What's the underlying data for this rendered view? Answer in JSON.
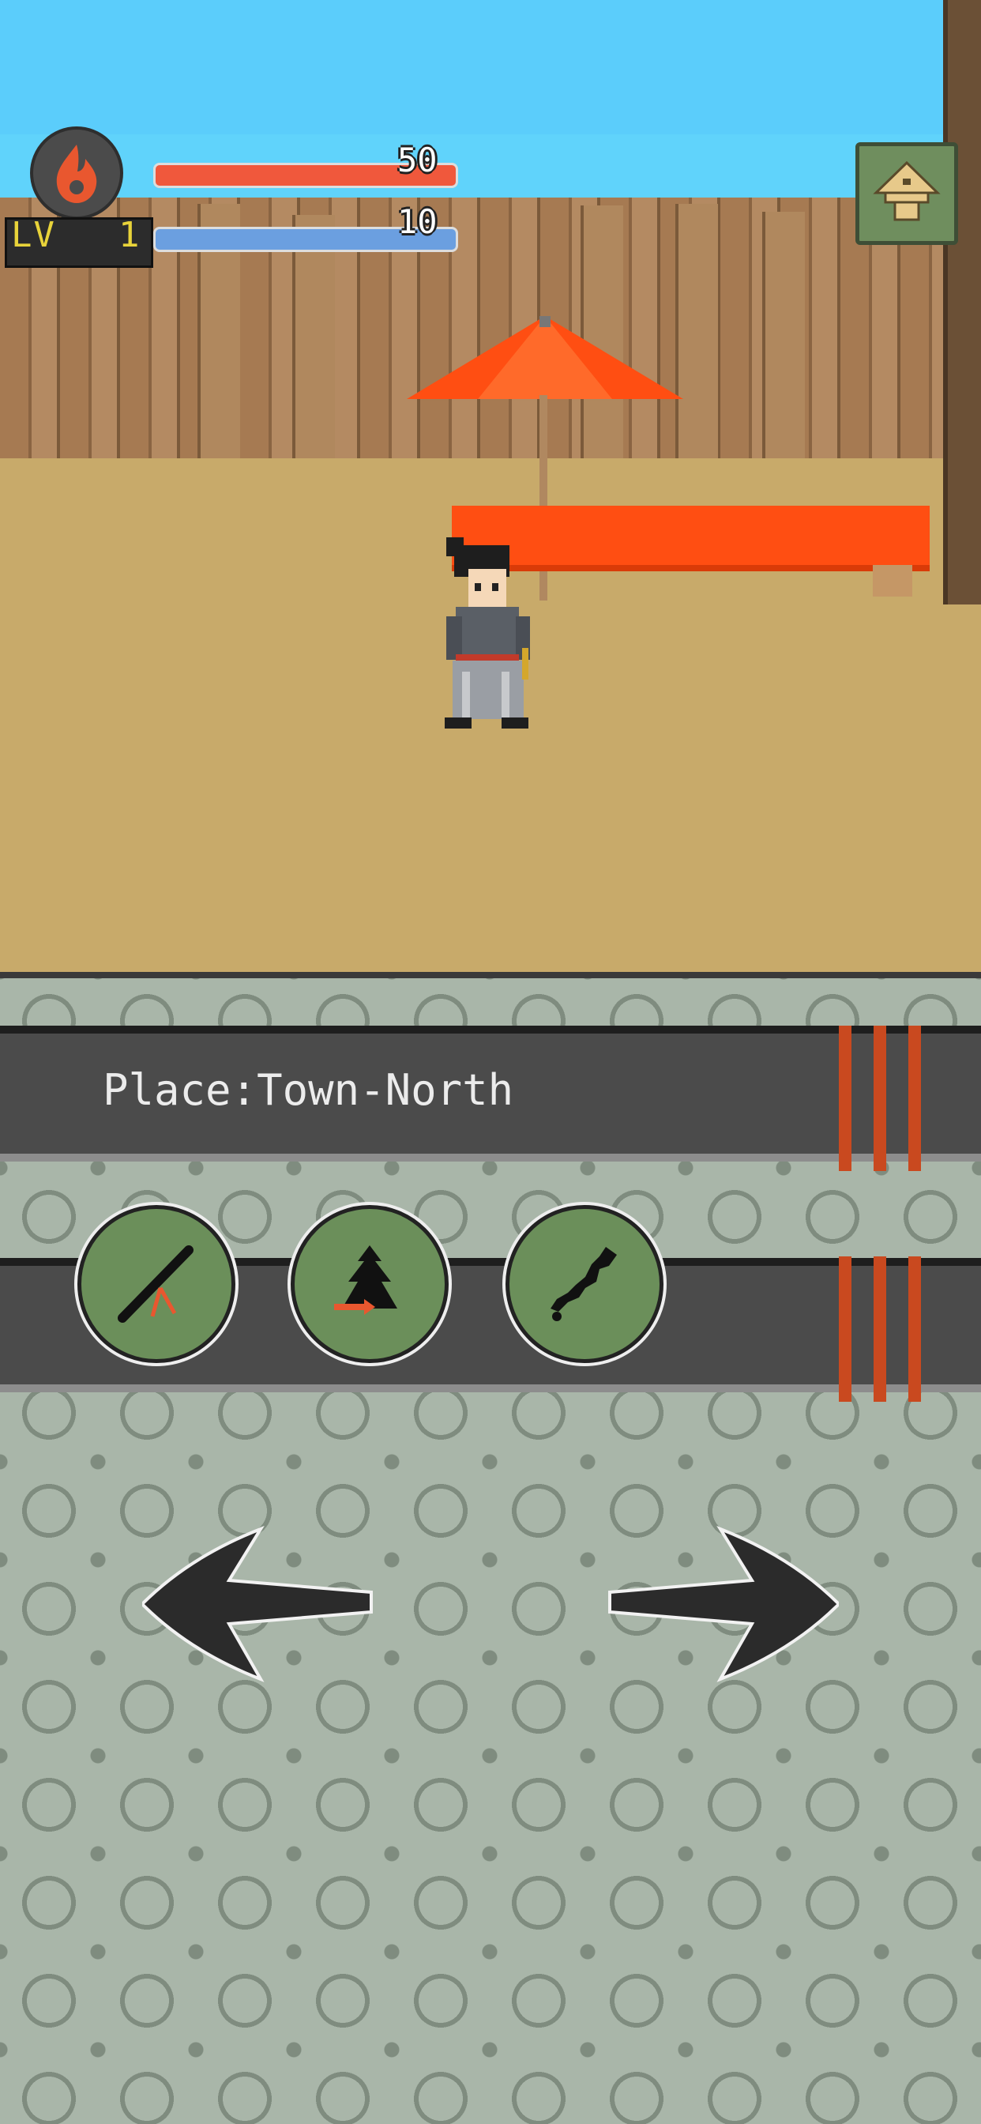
{
  "hud": {
    "level_label": "LV",
    "level": "1",
    "hp": "50",
    "mp": "10",
    "hp_fill": 1.0,
    "mp_fill": 1.0
  },
  "location": {
    "text": "Place:Town-North"
  },
  "actions": [
    {
      "icon": "sword-icon"
    },
    {
      "icon": "castle-exit-icon"
    },
    {
      "icon": "map-japan-icon"
    }
  ],
  "navigation": {
    "left_icon": "arrow-left-icon",
    "right_icon": "arrow-right-icon"
  },
  "colors": {
    "sky": "#5bcdfb",
    "ground": "#c8aa6a",
    "umbrella": "#ff4e12",
    "button_green": "#6b8f5a",
    "bar_dark": "#4b4b4b",
    "accent_stripe": "#c9491f",
    "hp": "#f0583c",
    "mp": "#6b9fe0",
    "level_text": "#e8d33a"
  }
}
